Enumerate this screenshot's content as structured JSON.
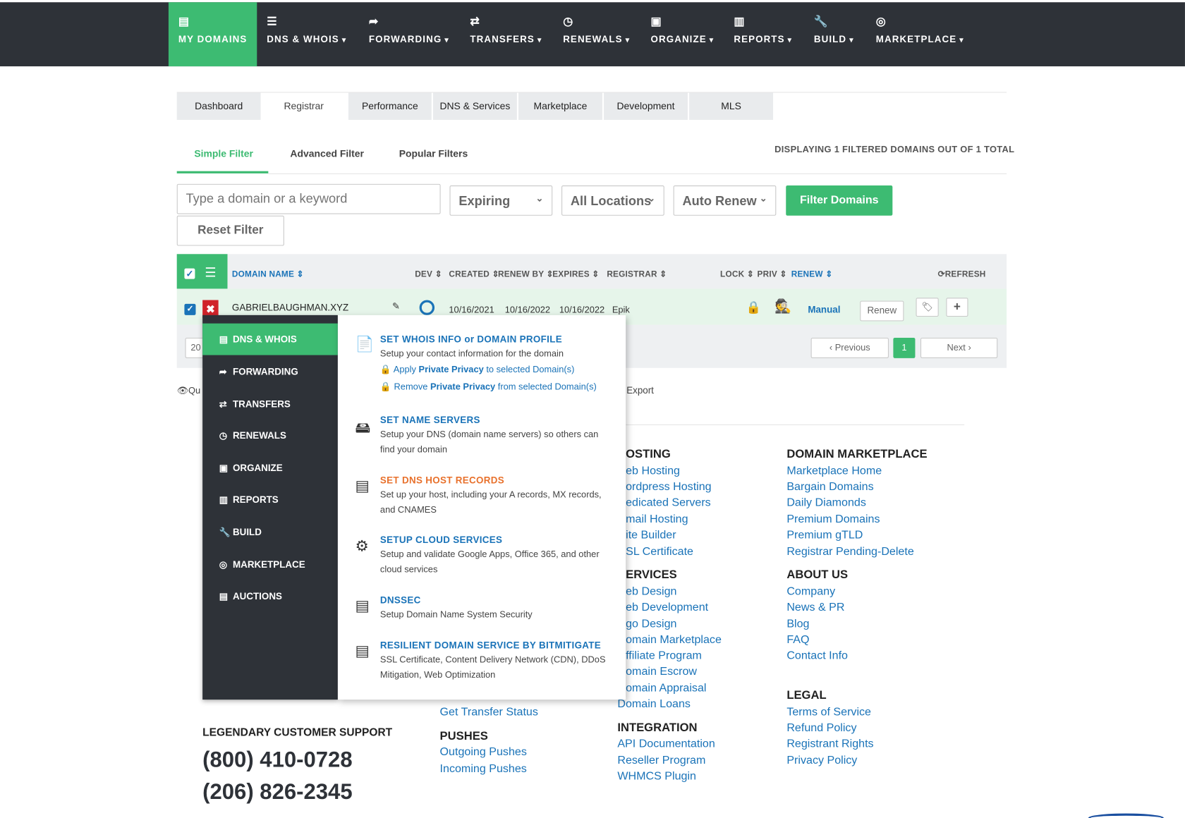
{
  "topnav": {
    "items": [
      {
        "label": "MY DOMAINS",
        "icon": "list-icon"
      },
      {
        "label": "DNS & WHOIS",
        "icon": "server-icon"
      },
      {
        "label": "FORWARDING",
        "icon": "share-icon"
      },
      {
        "label": "TRANSFERS",
        "icon": "exchange-icon"
      },
      {
        "label": "RENEWALS",
        "icon": "clock-icon"
      },
      {
        "label": "ORGANIZE",
        "icon": "briefcase-icon"
      },
      {
        "label": "REPORTS",
        "icon": "bar-chart-icon"
      },
      {
        "label": "BUILD",
        "icon": "wrench-icon"
      },
      {
        "label": "MARKETPLACE",
        "icon": "target-icon"
      }
    ]
  },
  "tabs": [
    "Dashboard",
    "Registrar",
    "Performance",
    "DNS & Services",
    "Marketplace",
    "Development",
    "MLS"
  ],
  "filter_tabs": [
    "Simple Filter",
    "Advanced Filter",
    "Popular Filters"
  ],
  "displaying": "DISPLAYING 1 FILTERED DOMAINS OUT OF 1 TOTAL",
  "filter": {
    "search_placeholder": "Type a domain or a keyword",
    "expiring": "Expiring",
    "locations": "All Locations",
    "auto_renew": "Auto Renew",
    "filter_button": "Filter Domains",
    "reset_button": "Reset Filter"
  },
  "table": {
    "headers": [
      "DOMAIN NAME",
      "DEV",
      "CREATED",
      "RENEW BY",
      "EXPIRES",
      "REGISTRAR",
      "LOCK",
      "PRIV",
      "RENEW",
      "REFRESH"
    ],
    "row": {
      "domain": "GABRIELBAUGHMAN.XYZ",
      "created": "10/16/2021",
      "renew_by": "10/16/2022",
      "expires": "10/16/2022",
      "registrar": "Epik",
      "renew_mode": "Manual",
      "renew_button": "Renew"
    }
  },
  "pager": {
    "page_size": "20",
    "previous": "Previous",
    "current": "1",
    "next": "Next"
  },
  "below_table": {
    "left_fragment": "Qu",
    "export": "Export"
  },
  "dropdown": {
    "side": [
      "DNS & WHOIS",
      "FORWARDING",
      "TRANSFERS",
      "RENEWALS",
      "ORGANIZE",
      "REPORTS",
      "BUILD",
      "MARKETPLACE",
      "AUCTIONS"
    ],
    "items": [
      {
        "title": "SET WHOIS INFO or DOMAIN PROFILE",
        "desc": "Setup your contact information for the domain"
      },
      {
        "title": "SET NAME SERVERS",
        "desc": "Setup your DNS (domain name servers) so others can find your domain"
      },
      {
        "title": "SET DNS HOST RECORDS",
        "desc": "Set up your host, including your A records, MX records, and CNAMES"
      },
      {
        "title": "SETUP CLOUD SERVICES",
        "desc": "Setup and validate Google Apps, Office 365, and other cloud services"
      },
      {
        "title": "DNSSEC",
        "desc": "Setup Domain Name System Security"
      },
      {
        "title": "RESILIENT DOMAIN SERVICE BY BITMITIGATE",
        "desc": "SSL Certificate, Content Delivery Network (CDN), DDoS Mitigation, Web Optimization"
      }
    ],
    "privacy_apply": {
      "pre": "Apply ",
      "bold": "Private Privacy",
      "post": " to selected Domain(s)"
    },
    "privacy_remove": {
      "pre": "Remove ",
      "bold": "Private Privacy",
      "post": " from selected Domain(s)"
    }
  },
  "footer": {
    "hosting": {
      "title": "OSTING",
      "links": [
        "eb Hosting",
        "ordpress Hosting",
        "edicated Servers",
        "mail Hosting",
        "ite Builder",
        "SL Certificate"
      ]
    },
    "services": {
      "title": "ERVICES",
      "links": [
        "eb Design",
        "eb Development",
        "go Design",
        "omain Marketplace",
        "ffiliate Program",
        "omain Escrow",
        "omain Appraisal",
        "Domain Loans"
      ]
    },
    "integration": {
      "title": "INTEGRATION",
      "links": [
        "API Documentation",
        "Reseller Program",
        "WHMCS Plugin"
      ]
    },
    "marketplace": {
      "title": "DOMAIN MARKETPLACE",
      "links": [
        "Marketplace Home",
        "Bargain Domains",
        "Daily Diamonds",
        "Premium Domains",
        "Premium gTLD",
        "Registrar Pending-Delete"
      ]
    },
    "about": {
      "title": "ABOUT US",
      "links": [
        "Company",
        "News & PR",
        "Blog",
        "FAQ",
        "Contact Info"
      ]
    },
    "legal": {
      "title": "LEGAL",
      "links": [
        "Terms of Service",
        "Refund Policy",
        "Registrant Rights",
        "Privacy Policy"
      ]
    },
    "transfer_status": "Get Transfer Status",
    "pushes": {
      "title": "PUSHES",
      "links": [
        "Outgoing Pushes",
        "Incoming Pushes"
      ]
    },
    "support_title": "LEGENDARY CUSTOMER SUPPORT",
    "phone1": "(800) 410-0728",
    "phone2": "(206) 826-2345"
  }
}
